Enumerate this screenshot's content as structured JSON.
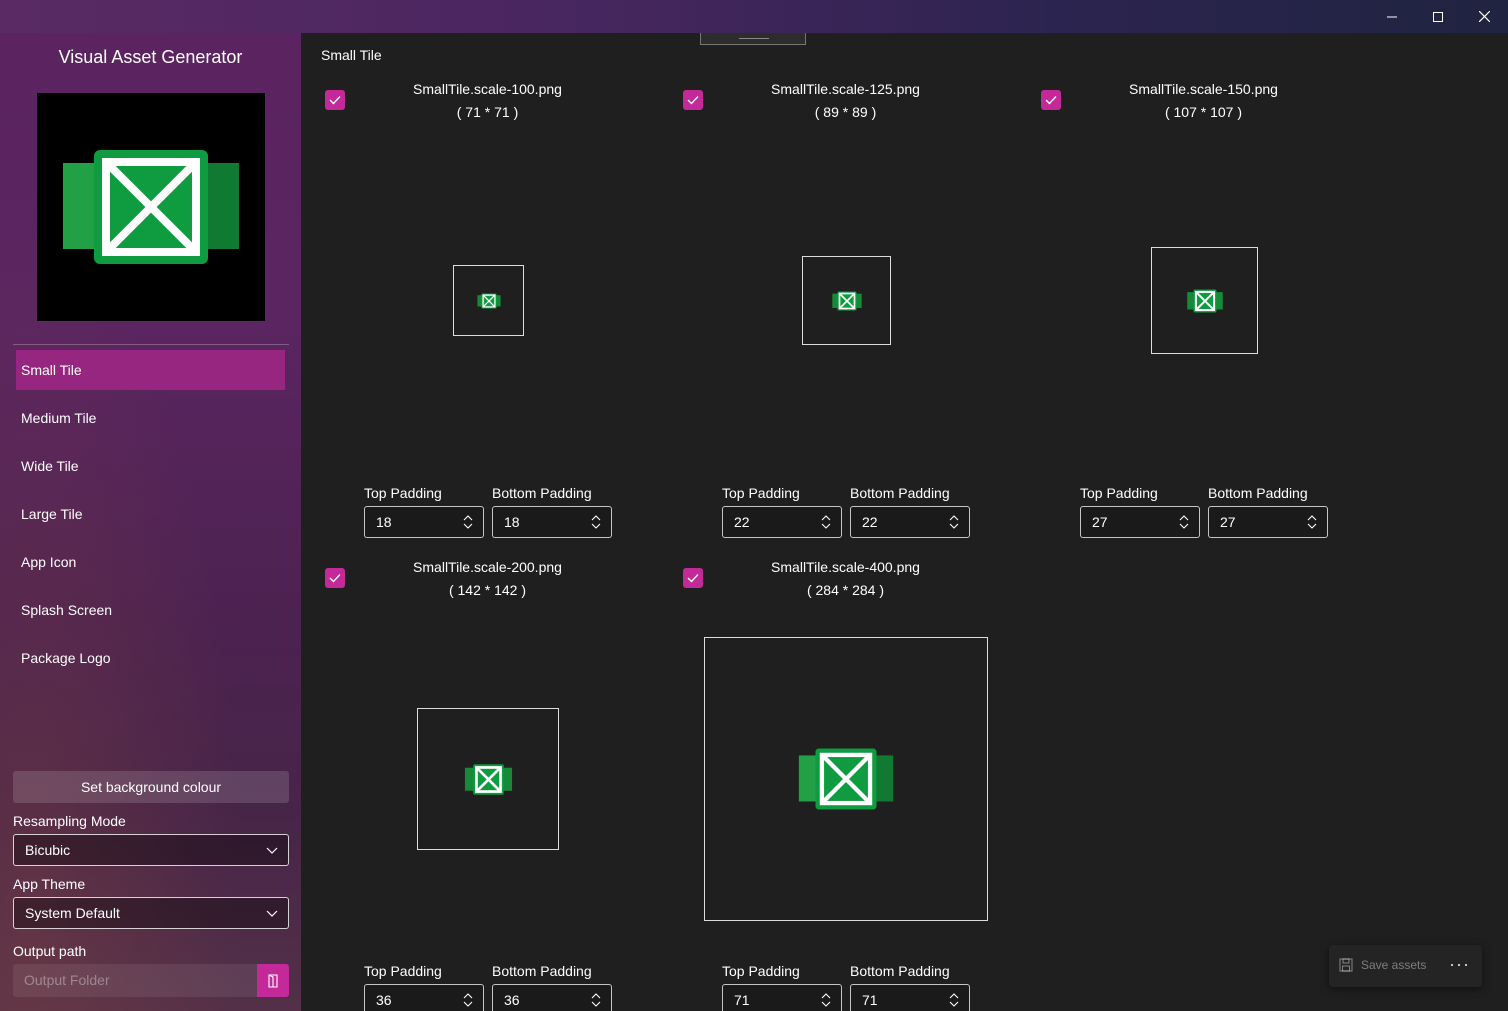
{
  "window": {
    "minimize_glyph": "—",
    "maximize_glyph": "☐",
    "close_glyph": "✕"
  },
  "sidebar": {
    "app_title": "Visual Asset Generator",
    "nav": [
      {
        "label": "Small Tile",
        "active": true
      },
      {
        "label": "Medium Tile",
        "active": false
      },
      {
        "label": "Wide Tile",
        "active": false
      },
      {
        "label": "Large Tile",
        "active": false
      },
      {
        "label": "App Icon",
        "active": false
      },
      {
        "label": "Splash Screen",
        "active": false
      },
      {
        "label": "Package Logo",
        "active": false
      }
    ],
    "bg_button_label": "Set background colour",
    "resampling_label": "Resampling Mode",
    "resampling_value": "Bicubic",
    "theme_label": "App Theme",
    "theme_value": "System Default",
    "output_label": "Output path",
    "output_placeholder": "Output Folder"
  },
  "main": {
    "section_title": "Small Tile",
    "top_padding_label": "Top Padding",
    "bottom_padding_label": "Bottom Padding",
    "assets": [
      {
        "filename": "SmallTile.scale-100.png",
        "size": "( 71 * 71 )",
        "checked": true,
        "top_padding": "18",
        "bottom_padding": "18"
      },
      {
        "filename": "SmallTile.scale-125.png",
        "size": "( 89 * 89 )",
        "checked": true,
        "top_padding": "22",
        "bottom_padding": "22"
      },
      {
        "filename": "SmallTile.scale-150.png",
        "size": "( 107 * 107 )",
        "checked": true,
        "top_padding": "27",
        "bottom_padding": "27"
      },
      {
        "filename": "SmallTile.scale-200.png",
        "size": "( 142 * 142 )",
        "checked": true,
        "top_padding": "36",
        "bottom_padding": "36"
      },
      {
        "filename": "SmallTile.scale-400.png",
        "size": "( 284 * 284 )",
        "checked": true,
        "top_padding": "71",
        "bottom_padding": "71"
      }
    ]
  },
  "command_bar": {
    "save_label": "Save assets",
    "more_glyph": "···"
  },
  "colors": {
    "accent": "#c4299a",
    "nav_active": "#96267f",
    "logo_green": "#0f9b3f"
  }
}
